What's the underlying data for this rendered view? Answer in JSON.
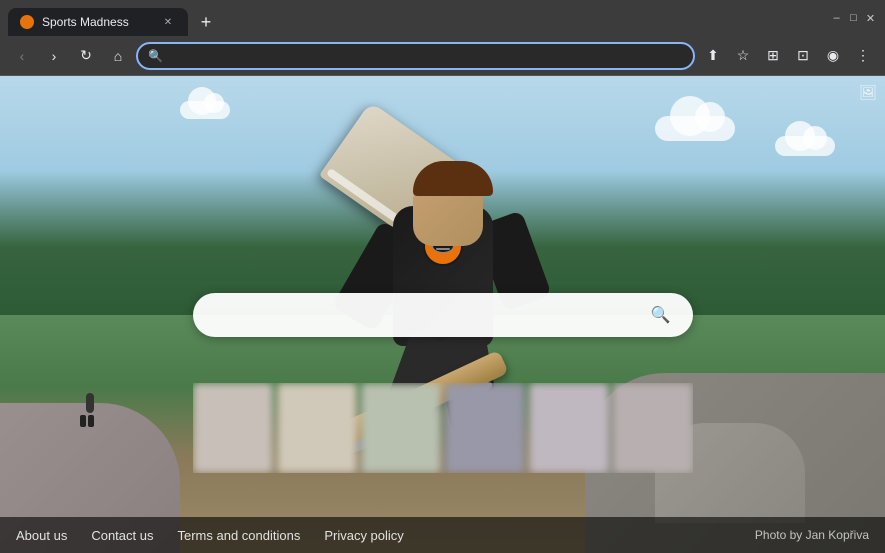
{
  "browser": {
    "tab_title": "Sports Madness",
    "tab_favicon_alt": "sports-madness-favicon",
    "new_tab_label": "+",
    "window_controls": {
      "minimize": "–",
      "maximize": "□",
      "close": "✕"
    },
    "toolbar": {
      "back_label": "‹",
      "forward_label": "›",
      "reload_label": "↻",
      "home_label": "⌂",
      "address_placeholder": "",
      "share_label": "⬆",
      "bookmark_label": "☆",
      "extension_label": "⊞",
      "split_label": "⊡",
      "profile_label": "◉",
      "menu_label": "⋮"
    }
  },
  "page": {
    "search_placeholder": "",
    "search_icon": "🔍",
    "image_icon": "🖼",
    "logo_alt": "sports-madness-logo"
  },
  "footer": {
    "links": [
      {
        "label": "About us"
      },
      {
        "label": "Contact us"
      },
      {
        "label": "Terms and conditions"
      },
      {
        "label": "Privacy policy"
      }
    ],
    "credit": "Photo by Jan Kopřiva"
  },
  "blurred_blocks": [
    {
      "color": "#c8c0b8"
    },
    {
      "color": "#d0c8b8"
    },
    {
      "color": "#b8c0b0"
    },
    {
      "color": "#9898a8"
    },
    {
      "color": "#c0b8c0"
    },
    {
      "color": "#b8b0b0"
    }
  ]
}
